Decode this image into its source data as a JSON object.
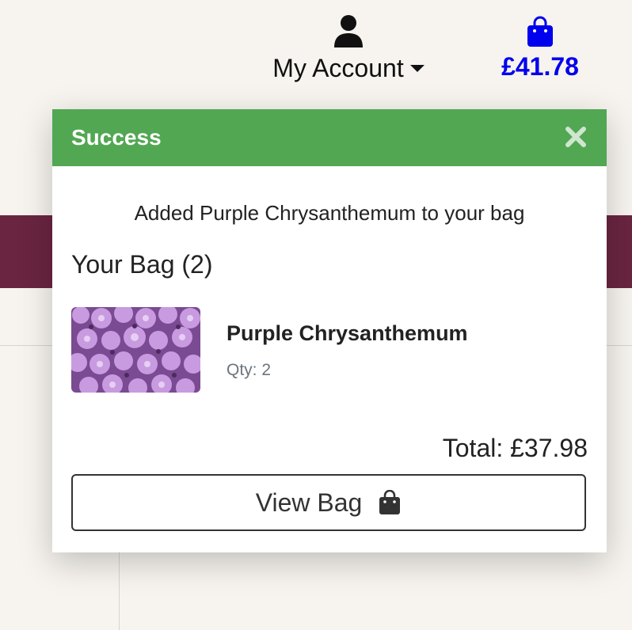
{
  "header": {
    "account": {
      "label": "My Account",
      "icon": "user-icon"
    },
    "bag": {
      "amount": "£41.78",
      "icon": "shopping-bag-icon",
      "color": "#0000ee"
    }
  },
  "colors": {
    "accent_stripe": "#6a2540",
    "success": "#52a753"
  },
  "toast": {
    "title": "Success",
    "close_icon": "close-icon",
    "message": "Added Purple Chrysanthemum to your bag",
    "bag_heading": "Your Bag (2)",
    "items": [
      {
        "name": "Purple Chrysanthemum",
        "qty": "Qty: 2",
        "image": "purple-chrysanthemum-photo"
      }
    ],
    "total": "Total: £37.98",
    "view_bag_label": "View Bag",
    "view_bag_icon": "shopping-bag-icon"
  }
}
